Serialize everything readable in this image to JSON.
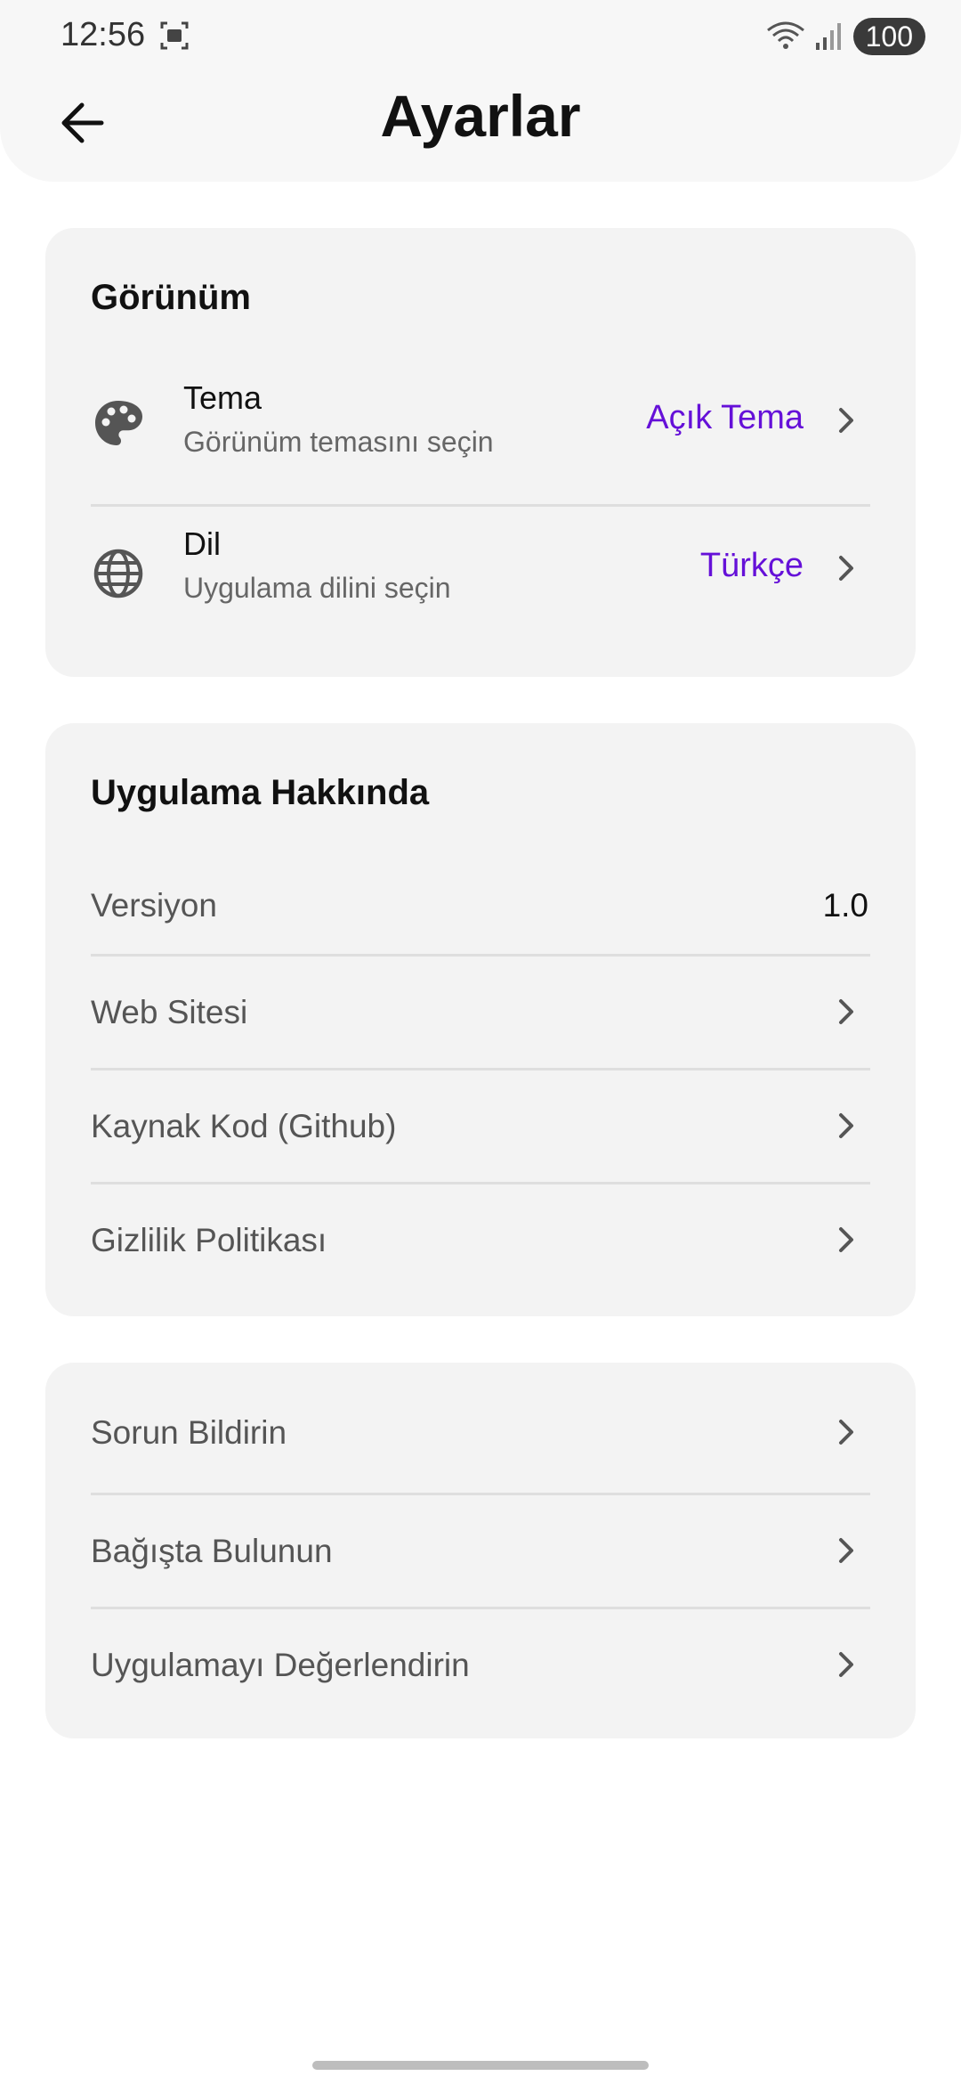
{
  "status_bar": {
    "time": "12:56",
    "battery": "100"
  },
  "header": {
    "title": "Ayarlar"
  },
  "appearance": {
    "title": "Görünüm",
    "theme": {
      "title": "Tema",
      "subtitle": "Görünüm temasını seçin",
      "value": "Açık Tema"
    },
    "language": {
      "title": "Dil",
      "subtitle": "Uygulama dilini seçin",
      "value": "Türkçe"
    }
  },
  "about": {
    "title": "Uygulama Hakkında",
    "version_label": "Versiyon",
    "version_value": "1.0",
    "website": "Web Sitesi",
    "source_code": "Kaynak Kod (Github)",
    "privacy": "Gizlilik Politikası"
  },
  "more": {
    "report": "Sorun Bildirin",
    "donate": "Bağışta Bulunun",
    "rate": "Uygulamayı Değerlendirin"
  },
  "colors": {
    "accent": "#6510d8",
    "card": "#f3f3f3",
    "header": "#f7f7f7"
  }
}
